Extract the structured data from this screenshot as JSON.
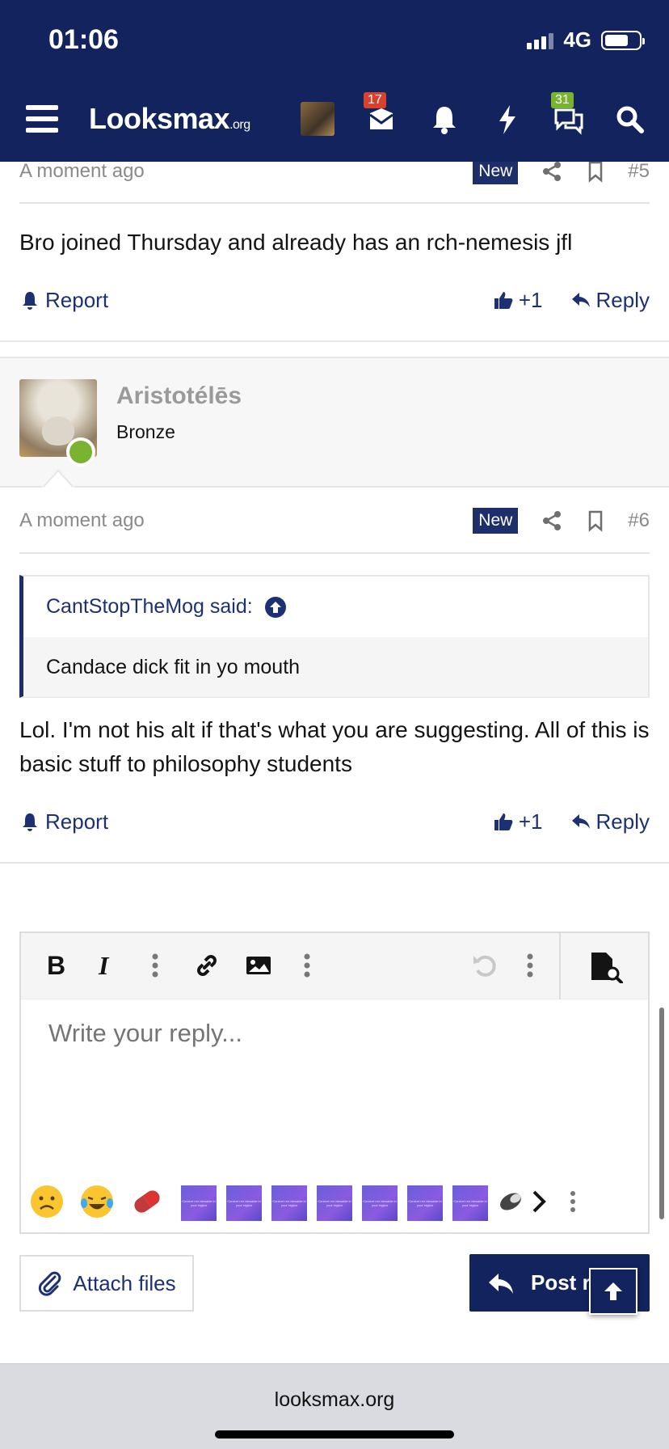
{
  "status_bar": {
    "time": "01:06",
    "network": "4G",
    "battery_level": 0.7
  },
  "nav": {
    "logo_main": "Looksmax",
    "logo_suffix": ".org",
    "inbox_badge": "17",
    "messages_badge": "31",
    "badge_colors": {
      "inbox": "#d9412f",
      "messages": "#7ab32f"
    }
  },
  "post5": {
    "time": "A moment ago",
    "new_label": "New",
    "number": "#5",
    "body": "Bro joined Thursday and already has an rch-nemesis jfl",
    "report_label": "Report",
    "like_count": "+1",
    "reply_label": "Reply"
  },
  "post6": {
    "author": "Aristotélēs",
    "user_title": "Bronze",
    "time": "A moment ago",
    "new_label": "New",
    "number": "#6",
    "quote_author": "CantStopTheMog said:",
    "quote_text": "Candace dick fit in yo mouth",
    "body": "Lol. I'm not his alt if that's what you are suggesting. All of this is basic stuff to philosophy students",
    "report_label": "Report",
    "like_count": "+1",
    "reply_label": "Reply"
  },
  "editor": {
    "placeholder": "Write your reply...",
    "smiley_tile_text": "Content not viewable in your region"
  },
  "buttons": {
    "attach": "Attach files",
    "post_reply": "Post reply"
  },
  "footer": {
    "url": "looksmax.org"
  },
  "colors": {
    "brand": "#13235e",
    "link": "#1d3172",
    "online": "#7ab32f"
  }
}
